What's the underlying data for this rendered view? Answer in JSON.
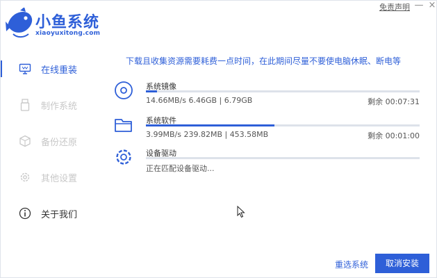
{
  "header": {
    "logo_title": "小鱼系统",
    "logo_subtitle": "xiaoyuxitong.com",
    "disclaimer": "免责声明",
    "minimize": "—",
    "close": "×"
  },
  "sidebar": {
    "items": [
      {
        "label": "在线重装",
        "icon": "monitor-icon",
        "state": "active"
      },
      {
        "label": "制作系统",
        "icon": "usb-drive-icon",
        "state": "disabled"
      },
      {
        "label": "备份还原",
        "icon": "backup-cube-icon",
        "state": "disabled"
      },
      {
        "label": "其他设置",
        "icon": "gear-icon",
        "state": "disabled"
      },
      {
        "label": "关于我们",
        "icon": "info-icon",
        "state": "normal"
      }
    ]
  },
  "main": {
    "notice": "下载且收集资源需要耗费一点时间，在此期间尽量不要使电脑休眠、断电等",
    "tasks": [
      {
        "name": "系统镜像",
        "icon": "disc-icon",
        "stats": "14.66MB/s 6.46GB | 6.79GB",
        "remaining": "剩余 00:07:31",
        "progress": 0.04
      },
      {
        "name": "系统软件",
        "icon": "folder-icon",
        "stats": "3.99MB/s 239.82MB | 453.58MB",
        "remaining": "剩余 00:01:00",
        "progress": 0.47
      },
      {
        "name": "设备驱动",
        "icon": "gear-icon",
        "status": "正在匹配设备驱动...",
        "progress": 0
      }
    ]
  },
  "footer": {
    "reselect_label": "重选系统",
    "cancel_label": "取消安装"
  },
  "colors": {
    "accent": "#2e5fd8",
    "disabled_text": "#c8c8c8",
    "track": "#dde2ea"
  }
}
